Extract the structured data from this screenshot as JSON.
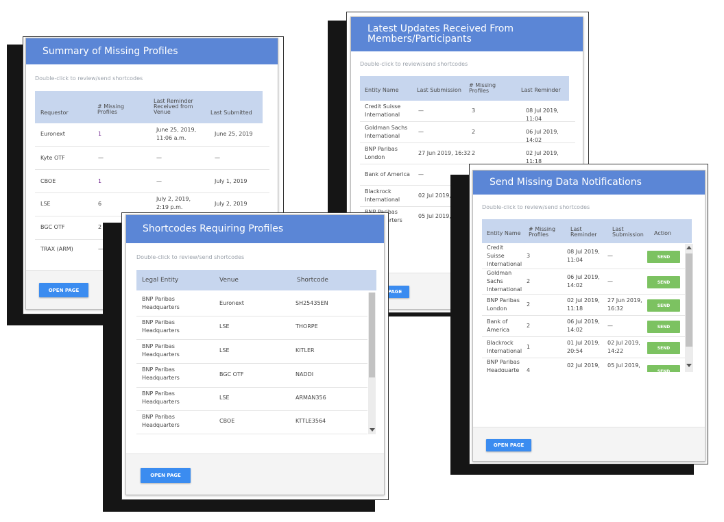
{
  "summary": {
    "title": "Summary of Missing Profiles",
    "hint": "Double-click to review/send shortcodes",
    "columns": [
      "Requestor",
      "# Missing Profiles",
      "Last Reminder Received from Venue",
      "Last Submitted"
    ],
    "rows": [
      [
        "Euronext",
        "1",
        "June 25, 2019, 11:06 a.m.",
        "June 25, 2019"
      ],
      [
        "Kyte OTF",
        "—",
        "—",
        "—"
      ],
      [
        "CBOE",
        "1",
        "—",
        "July 1, 2019"
      ],
      [
        "LSE",
        "6",
        "July 2, 2019, 2:19 p.m.",
        "July 2, 2019"
      ],
      [
        "BGC OTF",
        "2",
        "",
        ""
      ],
      [
        "TRAX (ARM)",
        "—",
        "",
        ""
      ]
    ],
    "button": "OPEN PAGE"
  },
  "shortcodes": {
    "title": "Shortcodes Requiring Profiles",
    "hint": "Double-click to review/send shortcodes",
    "columns": [
      "Legal Entity",
      "Venue",
      "Shortcode"
    ],
    "rows": [
      [
        "BNP Paribas Headquarters",
        "Euronext",
        "SH25435EN"
      ],
      [
        "BNP Paribas Headquarters",
        "LSE",
        "THORPE"
      ],
      [
        "BNP Paribas Headquarters",
        "LSE",
        "KITLER"
      ],
      [
        "BNP Paribas Headquarters",
        "BGC OTF",
        "NADDI"
      ],
      [
        "BNP Paribas Headquarters",
        "LSE",
        "ARMAN356"
      ],
      [
        "BNP Paribas Headquarters",
        "CBOE",
        "KTTLE3564"
      ]
    ],
    "button": "OPEN PAGE"
  },
  "updates": {
    "title": "Latest Updates Received From Members/Participants",
    "hint": "Double-click to review/send shortcodes",
    "columns": [
      "Entity Name",
      "Last Submission",
      "# Missing Profiles",
      "Last Reminder"
    ],
    "rows": [
      [
        "Credit Suisse International",
        "—",
        "3",
        "08 Jul 2019, 11:04"
      ],
      [
        "Goldman Sachs International",
        "—",
        "2",
        "06 Jul 2019, 14:02"
      ],
      [
        "BNP Paribas London",
        "27 Jun 2019, 16:32",
        "2",
        "02 Jul 2019, 11:18"
      ],
      [
        "Bank of America",
        "—",
        "",
        ""
      ],
      [
        "Blackrock International",
        "02 Jul 2019, 14:22",
        "",
        ""
      ],
      [
        "BNP Paribas Headquarters",
        "05 Jul 2019, 15:28",
        "",
        ""
      ]
    ],
    "button": "OPEN PAGE"
  },
  "notifications": {
    "title": "Send Missing Data Notifications",
    "hint": "Double-click to review/send shortcodes",
    "columns": [
      "Entity Name",
      "# Missing Profiles",
      "Last Reminder",
      "Last Submission",
      "Action"
    ],
    "rows": [
      [
        "Credit Suisse International",
        "3",
        "08 Jul 2019, 11:04",
        "—",
        "SEND"
      ],
      [
        "Goldman Sachs International",
        "2",
        "06 Jul 2019, 14:02",
        "—",
        "SEND"
      ],
      [
        "BNP Paribas London",
        "2",
        "02 Jul 2019, 11:18",
        "27 Jun 2019, 16:32",
        "SEND"
      ],
      [
        "Bank of America",
        "2",
        "06 Jul 2019, 14:02",
        "—",
        "SEND"
      ],
      [
        "Blackrock International",
        "1",
        "01 Jul 2019, 20:54",
        "02 Jul 2019, 14:22",
        "SEND"
      ],
      [
        "BNP Paribas Headquarte",
        "4",
        "02 Jul 2019,",
        "05 Jul 2019,",
        "SEND"
      ]
    ],
    "button": "OPEN PAGE"
  },
  "colors": {
    "header_blue": "#5b86d6",
    "table_header": "#c7d6ee",
    "button_blue": "#3b8cf0",
    "send_green": "#7cc261",
    "count_purple": "#6c1f8c"
  }
}
